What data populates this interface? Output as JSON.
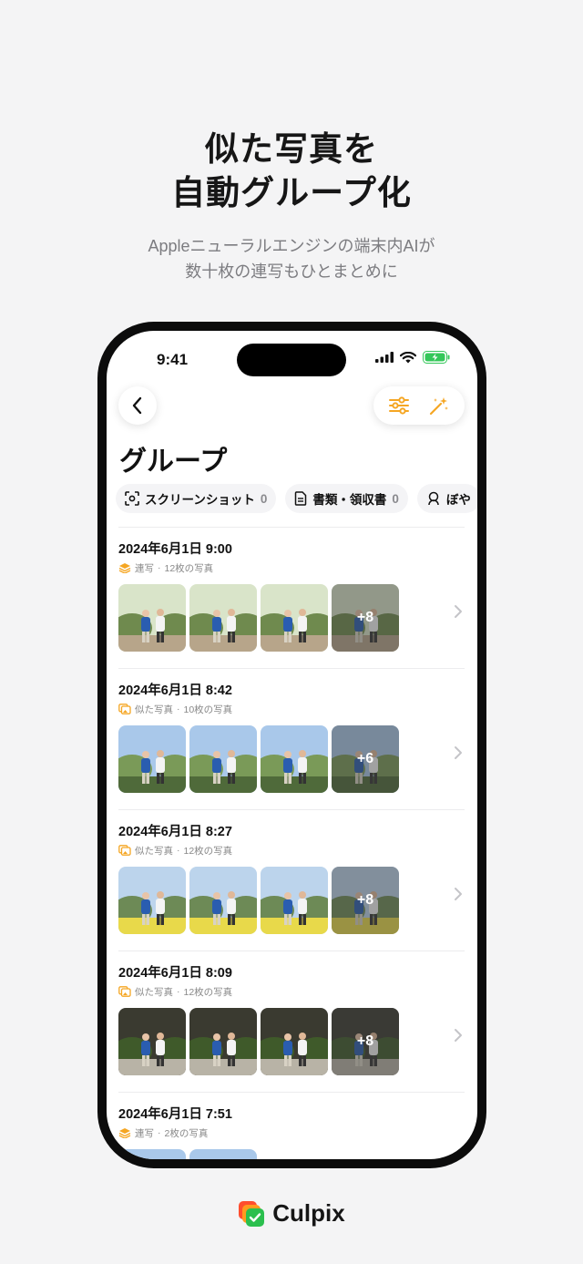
{
  "headline": {
    "line1": "似た写真を",
    "line2": "自動グループ化"
  },
  "subline": {
    "line1": "Appleニューラルエンジンの端末内AIが",
    "line2": "数十枚の連写もひとまとめに"
  },
  "status_bar": {
    "time": "9:41"
  },
  "page": {
    "title": "グループ"
  },
  "chips": [
    {
      "label": "スクリーンショット",
      "count": "0",
      "icon": "screenshot-icon"
    },
    {
      "label": "書類・領収書",
      "count": "0",
      "icon": "document-icon"
    },
    {
      "label": "ぼや",
      "count": "",
      "icon": "blur-icon"
    }
  ],
  "groups": [
    {
      "date": "2024年6月1日 9:00",
      "kind": "連写",
      "count_text": "12枚の写真",
      "kind_icon": "burst-icon",
      "more": "+8",
      "scene": "park"
    },
    {
      "date": "2024年6月1日 8:42",
      "kind": "似た写真",
      "count_text": "10枚の写真",
      "kind_icon": "similar-icon",
      "more": "+6",
      "scene": "sky"
    },
    {
      "date": "2024年6月1日 8:27",
      "kind": "似た写真",
      "count_text": "12枚の写真",
      "kind_icon": "similar-icon",
      "more": "+8",
      "scene": "view"
    },
    {
      "date": "2024年6月1日 8:09",
      "kind": "似た写真",
      "count_text": "12枚の写真",
      "kind_icon": "similar-icon",
      "more": "+8",
      "scene": "temple"
    },
    {
      "date": "2024年6月1日 7:51",
      "kind": "連写",
      "count_text": "2枚の写真",
      "kind_icon": "burst-icon",
      "more": "",
      "scene": "sky"
    }
  ],
  "brand": {
    "name": "Culpix"
  },
  "colors": {
    "accent": "#f5a623",
    "background": "#f4f4f5",
    "frame": "#0c0c0c"
  }
}
